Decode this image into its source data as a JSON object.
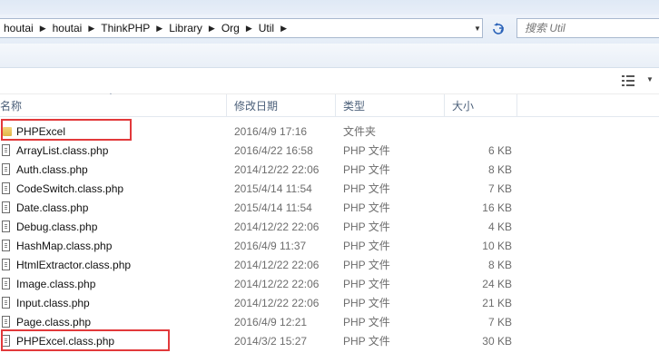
{
  "address": {
    "crumbs": [
      "houtai",
      "houtai",
      "ThinkPHP",
      "Library",
      "Org",
      "Util"
    ],
    "separator": "▶"
  },
  "search": {
    "placeholder": "搜索 Util"
  },
  "columns": {
    "name": "名称",
    "date": "修改日期",
    "type": "类型",
    "size": "大小"
  },
  "files": [
    {
      "name": "PHPExcel",
      "date": "2016/4/9 17:16",
      "type": "文件夹",
      "size": "",
      "kind": "folder"
    },
    {
      "name": "ArrayList.class.php",
      "date": "2016/4/22 16:58",
      "type": "PHP 文件",
      "size": "6 KB",
      "kind": "file"
    },
    {
      "name": "Auth.class.php",
      "date": "2014/12/22 22:06",
      "type": "PHP 文件",
      "size": "8 KB",
      "kind": "file"
    },
    {
      "name": "CodeSwitch.class.php",
      "date": "2015/4/14 11:54",
      "type": "PHP 文件",
      "size": "7 KB",
      "kind": "file"
    },
    {
      "name": "Date.class.php",
      "date": "2015/4/14 11:54",
      "type": "PHP 文件",
      "size": "16 KB",
      "kind": "file"
    },
    {
      "name": "Debug.class.php",
      "date": "2014/12/22 22:06",
      "type": "PHP 文件",
      "size": "4 KB",
      "kind": "file"
    },
    {
      "name": "HashMap.class.php",
      "date": "2016/4/9 11:37",
      "type": "PHP 文件",
      "size": "10 KB",
      "kind": "file"
    },
    {
      "name": "HtmlExtractor.class.php",
      "date": "2014/12/22 22:06",
      "type": "PHP 文件",
      "size": "8 KB",
      "kind": "file"
    },
    {
      "name": "Image.class.php",
      "date": "2014/12/22 22:06",
      "type": "PHP 文件",
      "size": "24 KB",
      "kind": "file"
    },
    {
      "name": "Input.class.php",
      "date": "2014/12/22 22:06",
      "type": "PHP 文件",
      "size": "21 KB",
      "kind": "file"
    },
    {
      "name": "Page.class.php",
      "date": "2016/4/9 12:21",
      "type": "PHP 文件",
      "size": "7 KB",
      "kind": "file"
    },
    {
      "name": "PHPExcel.class.php",
      "date": "2014/3/2 15:27",
      "type": "PHP 文件",
      "size": "30 KB",
      "kind": "file"
    }
  ],
  "highlights": [
    "PHPExcel",
    "PHPExcel.class.php"
  ],
  "colors": {
    "highlight": "#e2393b",
    "header_text": "#4c607a",
    "secondary_text": "#6d6d6d"
  },
  "icons": {
    "refresh": "refresh-icon",
    "dropdown": "chevron-down-icon",
    "view": "view-options-icon"
  }
}
